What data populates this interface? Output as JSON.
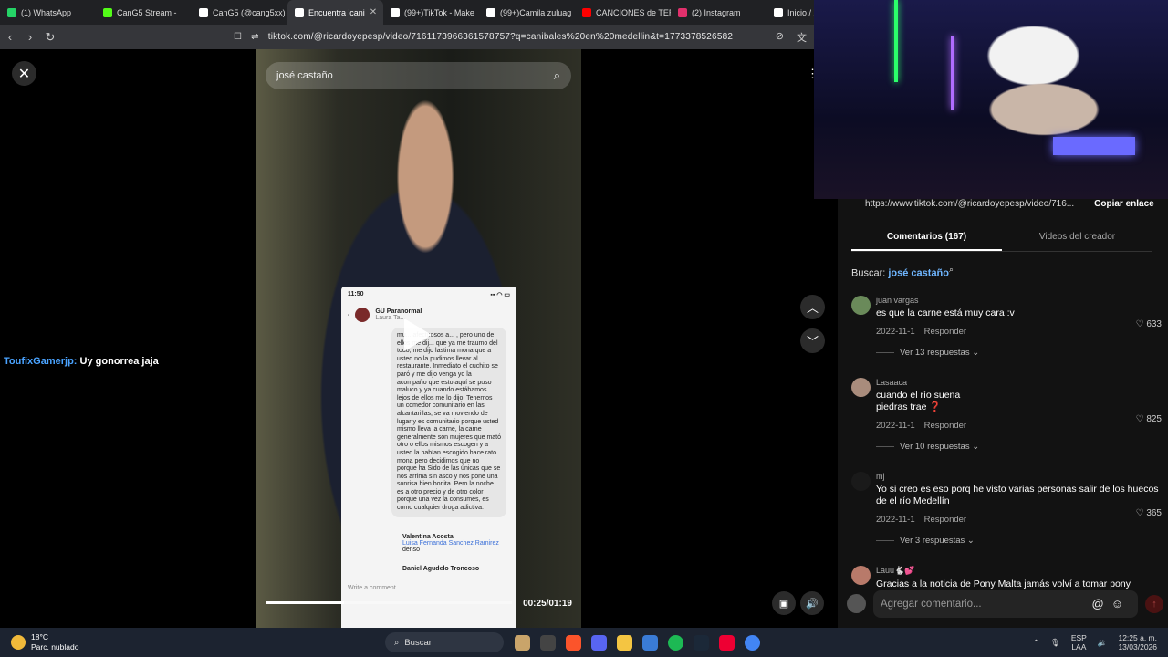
{
  "tabs": [
    {
      "label": "(1) WhatsApp",
      "color": "#25d366"
    },
    {
      "label": "CanG5 Stream -",
      "color": "#53fc18"
    },
    {
      "label": "CanG5 (@cang5xx)",
      "color": "#ffffff"
    },
    {
      "label": "Encuentra 'cani",
      "color": "#ffffff",
      "active": true
    },
    {
      "label": "(99+)TikTok - Make",
      "color": "#ffffff"
    },
    {
      "label": "(99+)Camila zuluag",
      "color": "#ffffff"
    },
    {
      "label": "CANCIONES de TER",
      "color": "#ff0000"
    },
    {
      "label": "(2) Instagram",
      "color": "#e1306c"
    },
    {
      "label": "Inicio / X",
      "color": "#ffffff"
    }
  ],
  "address": {
    "url": "tiktok.com/@ricardoyepesp/video/7161173966361578757?q=canibales%20en%20medellin&t=1773378526582"
  },
  "video": {
    "search_text": "josé castaño",
    "time": "00:25/01:19",
    "progress": 0.32,
    "phone": {
      "status_time": "11:50",
      "group": "GU Paranormal",
      "author": "Laura Ta...",
      "post_text": "mu... afectuosos a... , pero uno de ellos me dij... que ya me traumo del todo, me dijo lastima mona que a usted no la pudimos llevar al restaurante. Inmediato el cuchito se paró y me dijo venga yo la acompaño que esto aquí se puso maluco y ya cuando estábamos lejos de ellos me lo dijo. Tenemos un comedor comunitario en las alcantarillas, se va moviendo de lugar y es comunitario porque usted mismo lleva la carne, la carne generalmente son mujeres que mató otro o ellos mismos escogen y a usted la habían escogido hace rato mona pero decidimos que no porque ha Sido de las únicas que se nos arrima sin asco y nos pone una sonrisa bien bonita. Pero la noche es a otro precio y de otro color porque una vez la consumes, es como cualquier droga adictiva.",
      "reply_name": "Valentina Acosta",
      "reply_mention": "Luisa Fernanda Sanchez Ramirez",
      "reply_text": "denso",
      "next_name": "Daniel Agudelo Troncoso",
      "write": "Write a comment..."
    }
  },
  "chat": {
    "user": "ToufixGamerjp:",
    "message": "Uy gonorrea jaja"
  },
  "panel": {
    "link": "https://www.tiktok.com/@ricardoyepesp/video/716...",
    "copy_label": "Copiar enlace",
    "tab_comments": "Comentarios (167)",
    "tab_videos": "Videos del creador",
    "search_prefix": "Buscar:",
    "search_term": "josé castaño",
    "reply_label": "Responder",
    "comments": [
      {
        "user": "juan vargas",
        "text": "es que la carne está muy cara :v",
        "date": "2022-11-1",
        "likes": "633",
        "replies": "Ver 13 respuestas",
        "avatar": "#6a8a5a"
      },
      {
        "user": "Lasaaca",
        "text": "cuando el río suena\npiedras trae ❓",
        "date": "2022-11-1",
        "likes": "825",
        "replies": "Ver 10 respuestas",
        "avatar": "#a98c7c"
      },
      {
        "user": "mj",
        "text": "Yo si creo es eso porq he visto varias personas salir de los huecos de el río Medellín",
        "date": "2022-11-1",
        "likes": "365",
        "replies": "Ver 3 respuestas",
        "avatar": "#1a1a1a"
      },
      {
        "user": "Lauu🐇💕",
        "text": "Gracias a la noticia de Pony Malta jamás volví a tomar pony",
        "avatar": "#b87a6a"
      }
    ],
    "add_comment": "Agregar comentario..."
  },
  "taskbar": {
    "temp": "18°C",
    "weather": "Parc. nublado",
    "search": "Buscar",
    "lang1": "ESP",
    "lang2": "LAA",
    "time": "12:25 a. m.",
    "date": "13/03/2026"
  }
}
